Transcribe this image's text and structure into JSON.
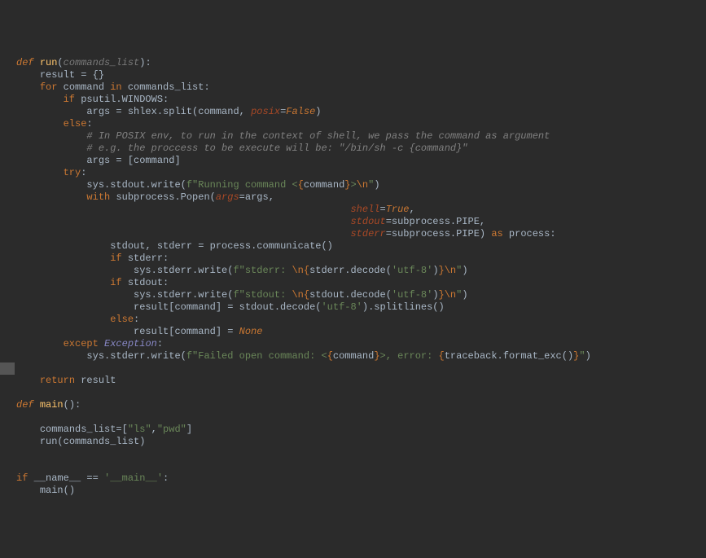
{
  "code": {
    "lines": [
      {
        "indent": 0,
        "tokens": [
          {
            "cls": "kw",
            "t": "def"
          },
          {
            "cls": "punct",
            "t": " "
          },
          {
            "cls": "fn",
            "t": "run"
          },
          {
            "cls": "punct",
            "t": "("
          },
          {
            "cls": "param",
            "t": "commands_list"
          },
          {
            "cls": "punct",
            "t": "):"
          }
        ]
      },
      {
        "indent": 1,
        "tokens": [
          {
            "cls": "punct",
            "t": "result = {}"
          }
        ]
      },
      {
        "indent": 1,
        "tokens": [
          {
            "cls": "kw-n",
            "t": "for "
          },
          {
            "cls": "punct",
            "t": "command "
          },
          {
            "cls": "kw-n",
            "t": "in "
          },
          {
            "cls": "punct",
            "t": "commands_list:"
          }
        ]
      },
      {
        "indent": 2,
        "tokens": [
          {
            "cls": "kw-n",
            "t": "if "
          },
          {
            "cls": "punct",
            "t": "psutil.WINDOWS:"
          }
        ]
      },
      {
        "indent": 3,
        "tokens": [
          {
            "cls": "punct",
            "t": "args = shlex.split(command"
          },
          {
            "cls": "punct",
            "t": ", "
          },
          {
            "cls": "kwarg",
            "t": "posix"
          },
          {
            "cls": "punct",
            "t": "="
          },
          {
            "cls": "bool",
            "t": "False"
          },
          {
            "cls": "punct",
            "t": ")"
          }
        ]
      },
      {
        "indent": 2,
        "tokens": [
          {
            "cls": "kw-n",
            "t": "else"
          },
          {
            "cls": "punct",
            "t": ":"
          }
        ]
      },
      {
        "indent": 3,
        "tokens": [
          {
            "cls": "comment",
            "t": "# In POSIX env, to run in the context of shell, we pass the command as argument"
          }
        ]
      },
      {
        "indent": 3,
        "tokens": [
          {
            "cls": "comment",
            "t": "# e.g. the proccess to be execute will be: \"/bin/sh -c {command}\""
          }
        ]
      },
      {
        "indent": 3,
        "tokens": [
          {
            "cls": "punct",
            "t": "args = [command]"
          }
        ]
      },
      {
        "indent": 2,
        "tokens": [
          {
            "cls": "kw-n",
            "t": "try"
          },
          {
            "cls": "punct",
            "t": ":"
          }
        ]
      },
      {
        "indent": 3,
        "tokens": [
          {
            "cls": "punct",
            "t": "sys.stdout.write("
          },
          {
            "cls": "str-pre",
            "t": "f"
          },
          {
            "cls": "str",
            "t": "\"Running command <"
          },
          {
            "cls": "fbrace",
            "t": "{"
          },
          {
            "cls": "punct",
            "t": "command"
          },
          {
            "cls": "fbrace",
            "t": "}"
          },
          {
            "cls": "str",
            "t": ">"
          },
          {
            "cls": "fbrace",
            "t": "\\n"
          },
          {
            "cls": "str",
            "t": "\""
          },
          {
            "cls": "punct",
            "t": ")"
          }
        ]
      },
      {
        "indent": 3,
        "tokens": [
          {
            "cls": "kw-n",
            "t": "with "
          },
          {
            "cls": "punct",
            "t": "subprocess.Popen("
          },
          {
            "cls": "kwarg",
            "t": "args"
          },
          {
            "cls": "punct",
            "t": "=args"
          },
          {
            "cls": "punct",
            "t": ","
          }
        ]
      },
      {
        "indent": 9,
        "raw": "                     ",
        "tokens": [
          {
            "cls": "kwarg",
            "t": "shell"
          },
          {
            "cls": "punct",
            "t": "="
          },
          {
            "cls": "bool",
            "t": "True"
          },
          {
            "cls": "punct",
            "t": ","
          }
        ]
      },
      {
        "indent": 9,
        "raw": "                     ",
        "tokens": [
          {
            "cls": "kwarg",
            "t": "stdout"
          },
          {
            "cls": "punct",
            "t": "=subprocess.PIPE"
          },
          {
            "cls": "punct",
            "t": ","
          }
        ]
      },
      {
        "indent": 9,
        "raw": "                     ",
        "tokens": [
          {
            "cls": "kwarg",
            "t": "stderr"
          },
          {
            "cls": "punct",
            "t": "=subprocess.PIPE) "
          },
          {
            "cls": "kw-n",
            "t": "as "
          },
          {
            "cls": "punct",
            "t": "process:"
          }
        ]
      },
      {
        "indent": 4,
        "tokens": [
          {
            "cls": "punct",
            "t": "stdout"
          },
          {
            "cls": "punct",
            "t": ", "
          },
          {
            "cls": "punct",
            "t": "stderr = process.communicate()"
          }
        ]
      },
      {
        "indent": 4,
        "tokens": [
          {
            "cls": "kw-n",
            "t": "if "
          },
          {
            "cls": "punct",
            "t": "stderr:"
          }
        ]
      },
      {
        "indent": 5,
        "tokens": [
          {
            "cls": "punct",
            "t": "sys.stderr.write("
          },
          {
            "cls": "str-pre",
            "t": "f"
          },
          {
            "cls": "str",
            "t": "\"stderr: "
          },
          {
            "cls": "fbrace",
            "t": "\\n{"
          },
          {
            "cls": "punct",
            "t": "stderr.decode("
          },
          {
            "cls": "str",
            "t": "'utf-8'"
          },
          {
            "cls": "punct",
            "t": ")"
          },
          {
            "cls": "fbrace",
            "t": "}\\n"
          },
          {
            "cls": "str",
            "t": "\""
          },
          {
            "cls": "punct",
            "t": ")"
          }
        ]
      },
      {
        "indent": 4,
        "tokens": [
          {
            "cls": "kw-n",
            "t": "if "
          },
          {
            "cls": "punct",
            "t": "stdout:"
          }
        ]
      },
      {
        "indent": 5,
        "tokens": [
          {
            "cls": "punct",
            "t": "sys.stderr.write("
          },
          {
            "cls": "str-pre",
            "t": "f"
          },
          {
            "cls": "str",
            "t": "\"stdout: "
          },
          {
            "cls": "fbrace",
            "t": "\\n{"
          },
          {
            "cls": "punct",
            "t": "stdout.decode("
          },
          {
            "cls": "str",
            "t": "'utf-8'"
          },
          {
            "cls": "punct",
            "t": ")"
          },
          {
            "cls": "fbrace",
            "t": "}\\n"
          },
          {
            "cls": "str",
            "t": "\""
          },
          {
            "cls": "punct",
            "t": ")"
          }
        ]
      },
      {
        "indent": 5,
        "tokens": [
          {
            "cls": "punct",
            "t": "result[command] = stdout.decode("
          },
          {
            "cls": "str",
            "t": "'utf-8'"
          },
          {
            "cls": "punct",
            "t": ").splitlines()"
          }
        ]
      },
      {
        "indent": 4,
        "tokens": [
          {
            "cls": "kw-n",
            "t": "else"
          },
          {
            "cls": "punct",
            "t": ":"
          }
        ]
      },
      {
        "indent": 5,
        "tokens": [
          {
            "cls": "punct",
            "t": "result[command] = "
          },
          {
            "cls": "bool",
            "t": "None"
          }
        ]
      },
      {
        "indent": 2,
        "tokens": [
          {
            "cls": "kw-n",
            "t": "except "
          },
          {
            "cls": "exc",
            "t": "Exception"
          },
          {
            "cls": "punct",
            "t": ":"
          }
        ]
      },
      {
        "indent": 3,
        "tokens": [
          {
            "cls": "punct",
            "t": "sys.stderr.write("
          },
          {
            "cls": "str-pre",
            "t": "f"
          },
          {
            "cls": "str",
            "t": "\"Failed open command: <"
          },
          {
            "cls": "fbrace",
            "t": "{"
          },
          {
            "cls": "punct",
            "t": "command"
          },
          {
            "cls": "fbrace",
            "t": "}"
          },
          {
            "cls": "str",
            "t": ">, error: "
          },
          {
            "cls": "fbrace",
            "t": "{"
          },
          {
            "cls": "punct",
            "t": "traceback.format_exc()"
          },
          {
            "cls": "fbrace",
            "t": "}"
          },
          {
            "cls": "str",
            "t": "\""
          },
          {
            "cls": "punct",
            "t": ")"
          }
        ]
      },
      {
        "indent": 0,
        "tokens": []
      },
      {
        "indent": 1,
        "tokens": [
          {
            "cls": "kw-n",
            "t": "return "
          },
          {
            "cls": "punct",
            "t": "result"
          }
        ]
      },
      {
        "indent": 0,
        "tokens": []
      },
      {
        "indent": 0,
        "tokens": [
          {
            "cls": "kw",
            "t": "def"
          },
          {
            "cls": "punct",
            "t": " "
          },
          {
            "cls": "fn",
            "t": "main"
          },
          {
            "cls": "punct",
            "t": "():"
          }
        ]
      },
      {
        "indent": 0,
        "tokens": []
      },
      {
        "indent": 1,
        "tokens": [
          {
            "cls": "punct",
            "t": "commands_list=["
          },
          {
            "cls": "str",
            "t": "\"ls\""
          },
          {
            "cls": "punct",
            "t": ","
          },
          {
            "cls": "str",
            "t": "\"pwd\""
          },
          {
            "cls": "punct",
            "t": "]"
          }
        ]
      },
      {
        "indent": 1,
        "tokens": [
          {
            "cls": "punct",
            "t": "run(commands_list)"
          }
        ]
      },
      {
        "indent": 0,
        "tokens": []
      },
      {
        "indent": 0,
        "tokens": []
      },
      {
        "indent": 0,
        "tokens": [
          {
            "cls": "kw-n",
            "t": "if "
          },
          {
            "cls": "punct",
            "t": "__name__ == "
          },
          {
            "cls": "str",
            "t": "'__main__'"
          },
          {
            "cls": "punct",
            "t": ":"
          }
        ]
      },
      {
        "indent": 1,
        "tokens": [
          {
            "cls": "punct",
            "t": "main()"
          }
        ]
      }
    ]
  },
  "cursor_line_index": 25,
  "indent_unit": "    "
}
